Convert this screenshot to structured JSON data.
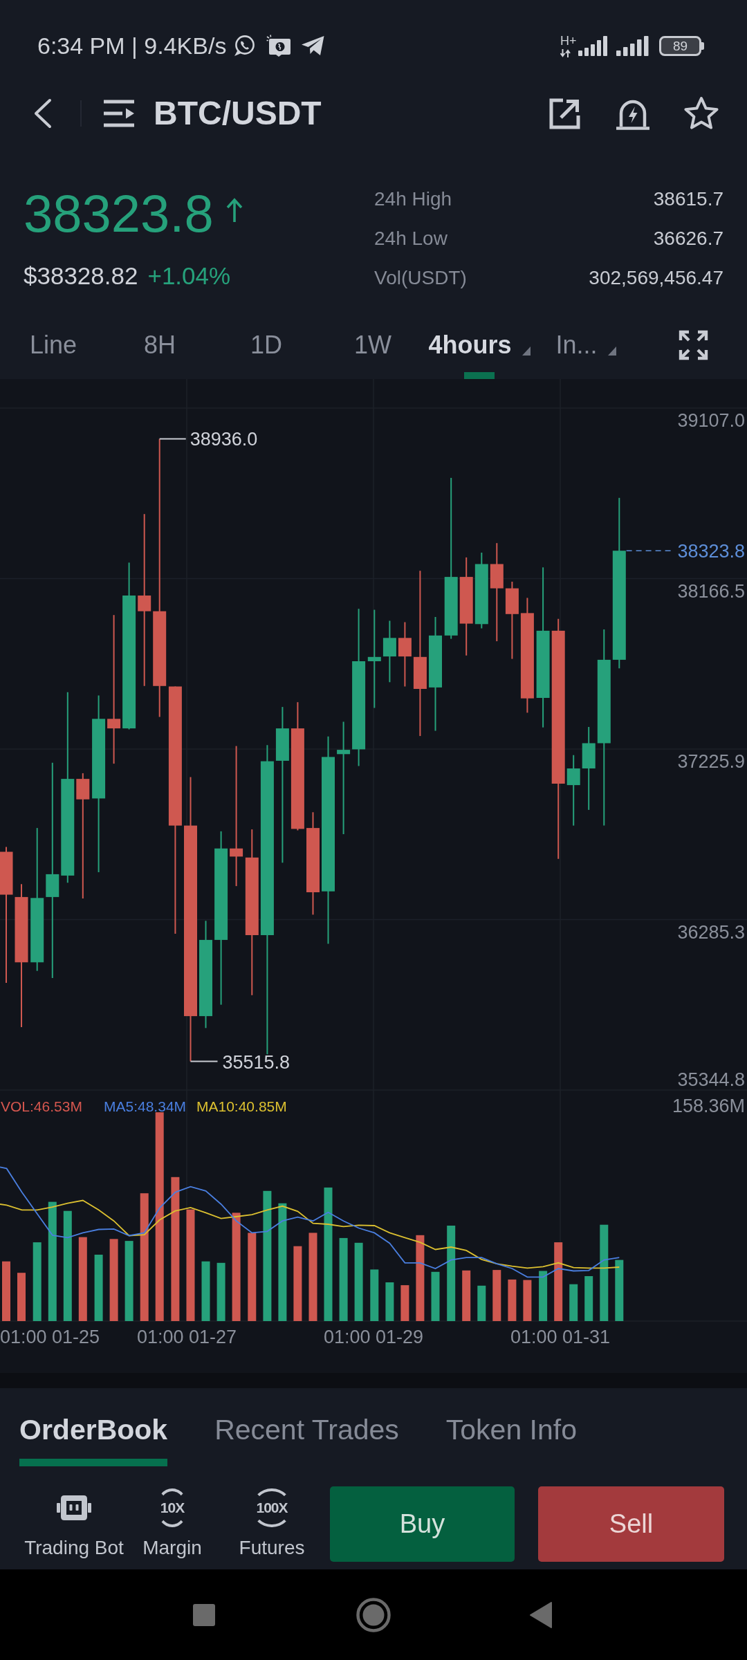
{
  "status_bar": {
    "text": "6:34 PM | 9.4KB/s",
    "network": "H+",
    "battery": "89"
  },
  "header": {
    "title": "BTC/USDT"
  },
  "ticker": {
    "last_price": "38323.8",
    "rising": true,
    "fiat_price": "$38328.82",
    "change": "+1.04%",
    "stats": [
      {
        "label": "24h High",
        "value": "38615.7"
      },
      {
        "label": "24h Low",
        "value": "36626.7"
      },
      {
        "label": "Vol(USDT)",
        "value": "302,569,456.47"
      }
    ]
  },
  "interval_tabs": [
    {
      "label": "Line",
      "selected": false,
      "dropdown": false
    },
    {
      "label": "8H",
      "selected": false,
      "dropdown": false
    },
    {
      "label": "1D",
      "selected": false,
      "dropdown": false
    },
    {
      "label": "1W",
      "selected": false,
      "dropdown": false
    },
    {
      "label": "4hours",
      "selected": true,
      "dropdown": true
    },
    {
      "label": "In...",
      "selected": false,
      "dropdown": true
    }
  ],
  "chart": {
    "price_axis": [
      "39107.0",
      "38166.5",
      "37225.9",
      "36285.3",
      "35344.8"
    ],
    "high_label": "38936.0",
    "low_label": "35515.8",
    "current_price": "38323.8",
    "volume_legend": [
      {
        "label": "VOL:46.53M",
        "color": "#d6574f"
      },
      {
        "label": "MA5:48.34M",
        "color": "#4a7fe0"
      },
      {
        "label": "MA10:40.85M",
        "color": "#dcc030"
      }
    ],
    "volume_axis": "158.36M",
    "time_axis": [
      "01:00 01-25",
      "01:00 01-27",
      "01:00 01-29",
      "01:00 01-31"
    ]
  },
  "panel_tabs": [
    {
      "label": "OrderBook",
      "selected": true
    },
    {
      "label": "Recent Trades",
      "selected": false
    },
    {
      "label": "Token Info",
      "selected": false
    }
  ],
  "shortcuts": [
    {
      "label": "Trading Bot",
      "kind": "bot"
    },
    {
      "label": "Margin",
      "kind": "leverage",
      "badge": "10X"
    },
    {
      "label": "Futures",
      "kind": "leverage",
      "badge": "100X"
    }
  ],
  "actions": [
    {
      "label": "Buy",
      "kind": "buy"
    },
    {
      "label": "Sell",
      "kind": "sell"
    }
  ]
}
